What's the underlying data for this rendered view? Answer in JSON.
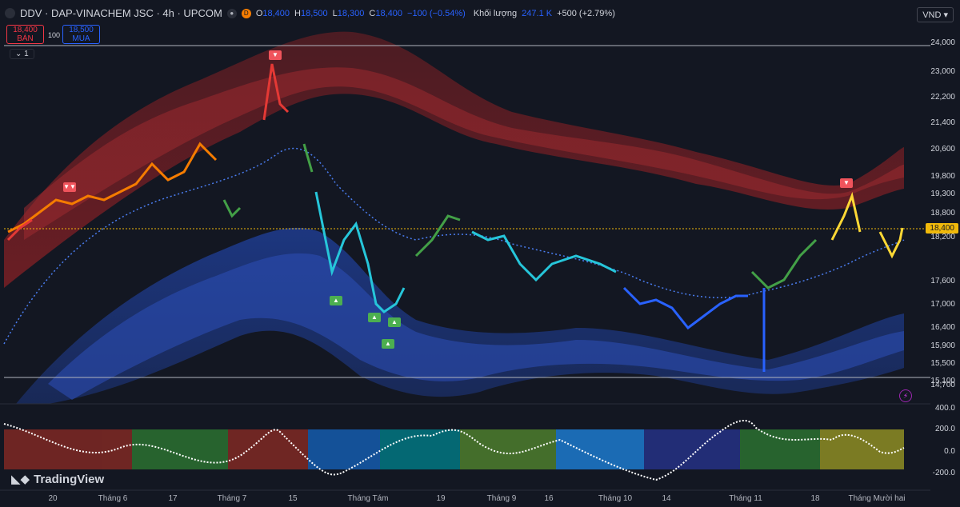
{
  "header": {
    "symbol": "DDV · DAP-VINACHEM JSC · 4h · UPCOM",
    "badge": "D",
    "o_label": "O",
    "o_value": "18,400",
    "h_label": "H",
    "h_value": "18,500",
    "l_label": "L",
    "l_value": "18,300",
    "c_label": "C",
    "c_value": "18,400",
    "change": "−100 (−0.54%)",
    "volume_label": "Khối lượng",
    "volume_value": "247.1 K",
    "volume_change": "+500 (+2.79%)"
  },
  "trade": {
    "sell_price": "18,400",
    "sell_label": "BÁN",
    "buy_price": "18,500",
    "buy_label": "MUA",
    "spread": "100"
  },
  "legend_toggle": "1",
  "currency": "VND",
  "price_axis": [
    "24,000",
    "23,000",
    "22,200",
    "21,400",
    "20,600",
    "19,800",
    "19,300",
    "18,800",
    "18,200",
    "17,600",
    "17,000",
    "16,400",
    "15,900",
    "15,500",
    "15,100",
    "14,700"
  ],
  "current_price": "18,400",
  "osc_axis": [
    "400.0",
    "200.0",
    "0.0",
    "-200.0"
  ],
  "time_axis": [
    "20",
    "Tháng 6",
    "17",
    "Tháng 7",
    "15",
    "Tháng Tám",
    "19",
    "Tháng 9",
    "16",
    "Tháng 10",
    "14",
    "Tháng 11",
    "18",
    "Tháng Mười hai"
  ],
  "brand": "TradingView",
  "colors": {
    "bg": "#131722",
    "red_band": "#7a1f24",
    "blue_band": "#1e3a8a",
    "price_line": "#f0b90b",
    "axis_text": "#d1d4dc"
  }
}
